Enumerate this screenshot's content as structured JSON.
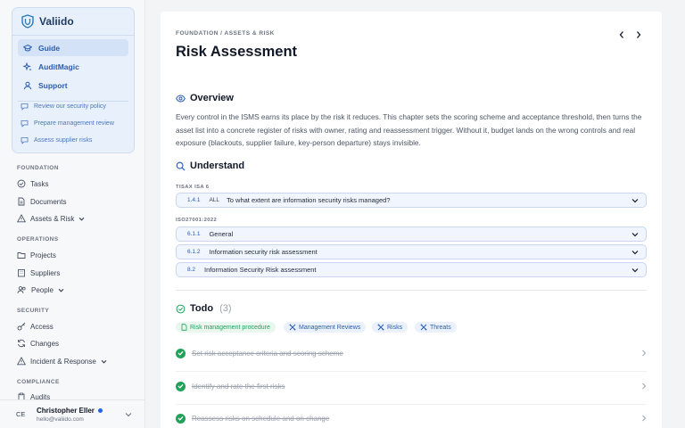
{
  "brand": {
    "name": "Valiido"
  },
  "nav": {
    "guide": "Guide",
    "auditmagic": "AuditMagic",
    "support": "Support"
  },
  "suggestions": [
    "Review our security policy",
    "Prepare management review",
    "Assess supplier risks"
  ],
  "sections": {
    "foundation": {
      "title": "FOUNDATION",
      "items": [
        "Tasks",
        "Documents",
        "Assets & Risk"
      ]
    },
    "operations": {
      "title": "OPERATIONS",
      "items": [
        "Projects",
        "Suppliers",
        "People"
      ]
    },
    "security": {
      "title": "SECURITY",
      "items": [
        "Access",
        "Changes",
        "Incident & Response"
      ]
    },
    "compliance": {
      "title": "COMPLIANCE",
      "items": [
        "Audits"
      ]
    }
  },
  "user": {
    "initials": "CE",
    "name": "Christopher Eller",
    "email": "hello@valiido.com"
  },
  "page": {
    "breadcrumb": "FOUNDATION / ASSETS & RISK",
    "title": "Risk Assessment",
    "overview_heading": "Overview",
    "overview_text": "Every control in the ISMS earns its place by the risk it reduces. This chapter sets the scoring scheme and acceptance threshold, then turns the asset list into a concrete register of risks with owner, rating and reassessment trigger. Without it, budget lands on the wrong controls and real exposure (blackouts, supplier failure, key-person departure) stays invisible.",
    "understand_heading": "Understand"
  },
  "tisax": {
    "label": "TISAX ISA 6",
    "items": [
      {
        "code": "1.4.1",
        "tag": "ALL",
        "text": "To what extent are information security risks managed?"
      }
    ]
  },
  "iso": {
    "label": "ISO27001:2022",
    "items": [
      {
        "code": "6.1.1",
        "text": "General"
      },
      {
        "code": "6.1.2",
        "text": "Information security risk assessment"
      },
      {
        "code": "8.2",
        "text": "Information Security Risk assessment"
      }
    ]
  },
  "todo": {
    "heading": "Todo",
    "count": "(3)",
    "chips": [
      "Risk management procedure",
      "Management Reviews",
      "Risks",
      "Threats"
    ],
    "items": [
      "Set risk acceptance criteria and scoring scheme",
      "Identify and rate the first risks",
      "Reassess risks on schedule and on change"
    ]
  },
  "colors": {
    "accent": "#2a5db0",
    "success": "#22a15a"
  }
}
